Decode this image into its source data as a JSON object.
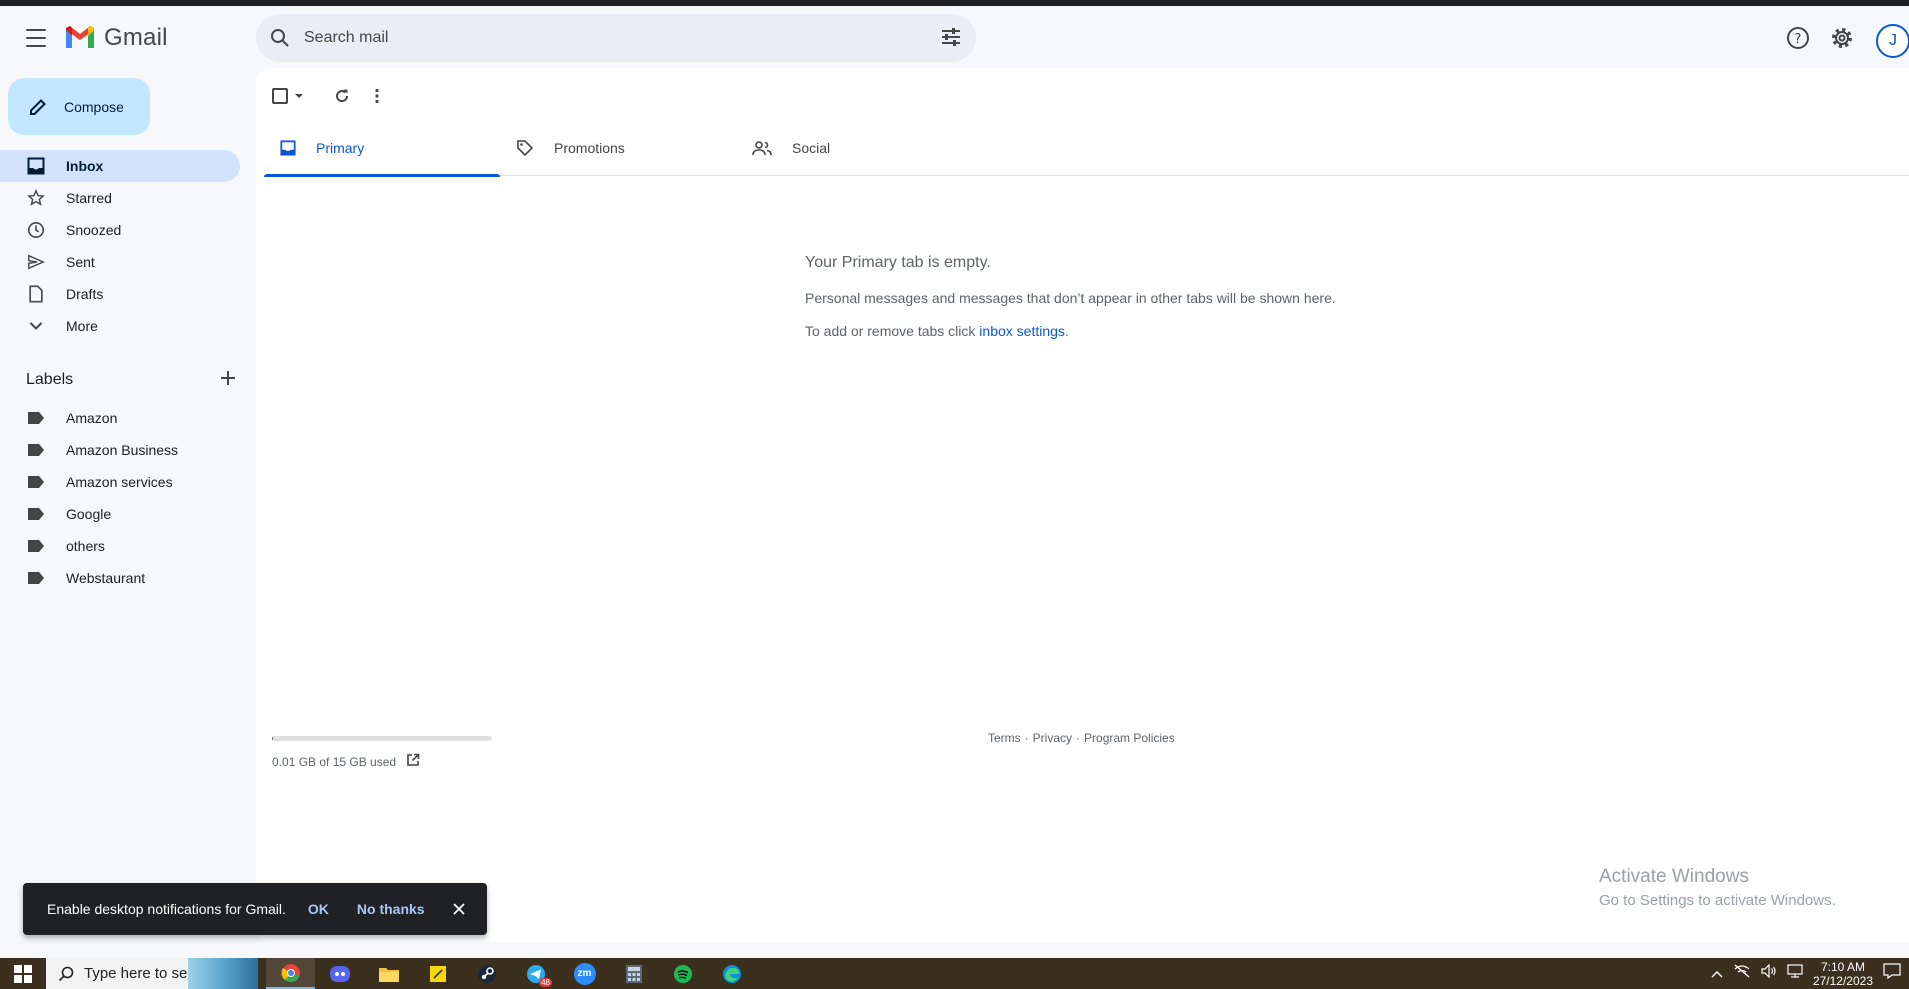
{
  "app": {
    "name": "Gmail"
  },
  "search": {
    "placeholder": "Search mail"
  },
  "header": {
    "avatar_initial": "J"
  },
  "compose": {
    "label": "Compose"
  },
  "nav": [
    {
      "label": "Inbox",
      "icon": "inbox-icon",
      "active": true
    },
    {
      "label": "Starred",
      "icon": "star-icon"
    },
    {
      "label": "Snoozed",
      "icon": "clock-icon"
    },
    {
      "label": "Sent",
      "icon": "send-icon"
    },
    {
      "label": "Drafts",
      "icon": "draft-icon"
    },
    {
      "label": "More",
      "icon": "chevron-down-icon"
    }
  ],
  "labels": {
    "title": "Labels",
    "items": [
      "Amazon",
      "Amazon Business",
      "Amazon services",
      "Google",
      "others",
      "Webstaurant"
    ]
  },
  "tabs": [
    {
      "label": "Primary",
      "icon": "inbox-icon",
      "active": true
    },
    {
      "label": "Promotions",
      "icon": "tag-icon"
    },
    {
      "label": "Social",
      "icon": "people-icon"
    }
  ],
  "empty": {
    "title": "Your Primary tab is empty.",
    "line1": "Personal messages and messages that don’t appear in other tabs will be shown here.",
    "line2_prefix": "To add or remove tabs click ",
    "line2_link": "inbox settings",
    "line2_suffix": "."
  },
  "storage": {
    "used_text": "0.01 GB of 15 GB used",
    "used_fraction": 0.001
  },
  "footer": {
    "terms": "Terms",
    "privacy": "Privacy",
    "policies": "Program Policies",
    "sep": "·"
  },
  "watermark": {
    "line1": "Activate Windows",
    "line2": "Go to Settings to activate Windows."
  },
  "notification": {
    "message": "Enable desktop notifications for Gmail.",
    "ok": "OK",
    "no_thanks": "No thanks"
  },
  "taskbar": {
    "search_placeholder": "Type here to search",
    "time": "7:10 AM",
    "date": "27/12/2023",
    "telegram_badge": "48",
    "zoom_label": "zm"
  },
  "colors": {
    "accent": "#0b57d0",
    "compose_bg": "#c2e7ff",
    "active_nav": "#d3e3fd",
    "background": "#f6f8fc"
  }
}
